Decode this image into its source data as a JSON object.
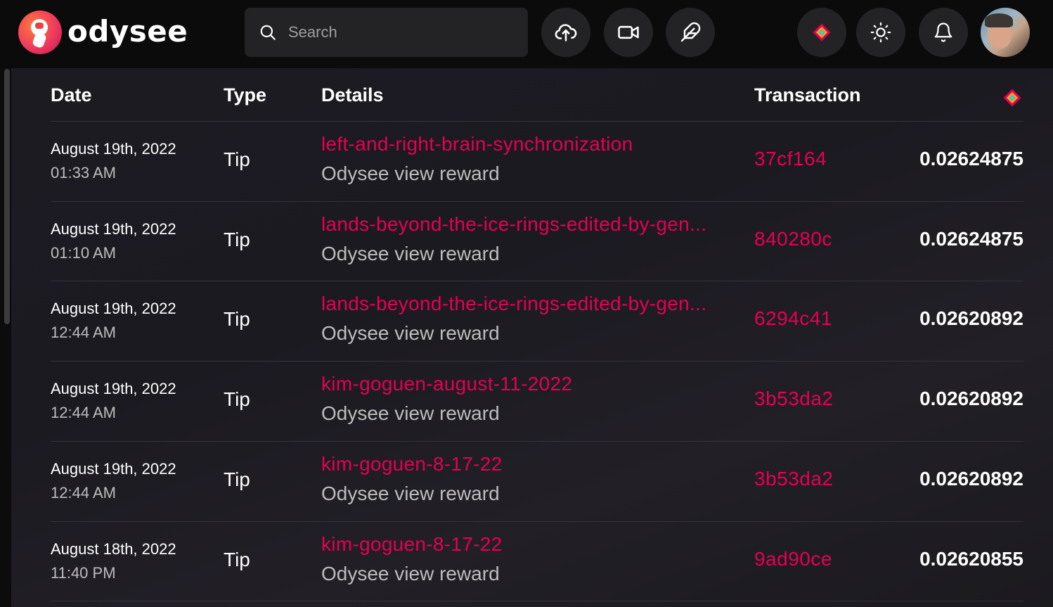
{
  "header": {
    "logo_text": "odysee",
    "search_placeholder": "Search",
    "icons": [
      "upload-icon",
      "video-camera-icon",
      "feather-pen-icon",
      "lbc-credits-icon",
      "sun-theme-icon",
      "bell-icon"
    ]
  },
  "table": {
    "columns": {
      "date": "Date",
      "type": "Type",
      "details": "Details",
      "transaction": "Transaction",
      "amount_icon": "lbc-credits-icon"
    },
    "rows": [
      {
        "date": "August 19th, 2022",
        "time": "01:33 AM",
        "type": "Tip",
        "claim": "left-and-right-brain-synchronization",
        "desc": "Odysee view reward",
        "txid": "37cf164",
        "amount": "0.02624875"
      },
      {
        "date": "August 19th, 2022",
        "time": "01:10 AM",
        "type": "Tip",
        "claim": "lands-beyond-the-ice-rings-edited-by-gen...",
        "desc": "Odysee view reward",
        "txid": "840280c",
        "amount": "0.02624875"
      },
      {
        "date": "August 19th, 2022",
        "time": "12:44 AM",
        "type": "Tip",
        "claim": "lands-beyond-the-ice-rings-edited-by-gen...",
        "desc": "Odysee view reward",
        "txid": "6294c41",
        "amount": "0.02620892"
      },
      {
        "date": "August 19th, 2022",
        "time": "12:44 AM",
        "type": "Tip",
        "claim": "kim-goguen-august-11-2022",
        "desc": "Odysee view reward",
        "txid": "3b53da2",
        "amount": "0.02620892"
      },
      {
        "date": "August 19th, 2022",
        "time": "12:44 AM",
        "type": "Tip",
        "claim": "kim-goguen-8-17-22",
        "desc": "Odysee view reward",
        "txid": "3b53da2",
        "amount": "0.02620892"
      },
      {
        "date": "August 18th, 2022",
        "time": "11:40 PM",
        "type": "Tip",
        "claim": "kim-goguen-8-17-22",
        "desc": "Odysee view reward",
        "txid": "9ad90ce",
        "amount": "0.02620855"
      }
    ]
  },
  "colors": {
    "accent": "#e50054",
    "background": "#0f0f10",
    "card": "#1d1b22",
    "muted_text": "#bdbdbd"
  }
}
